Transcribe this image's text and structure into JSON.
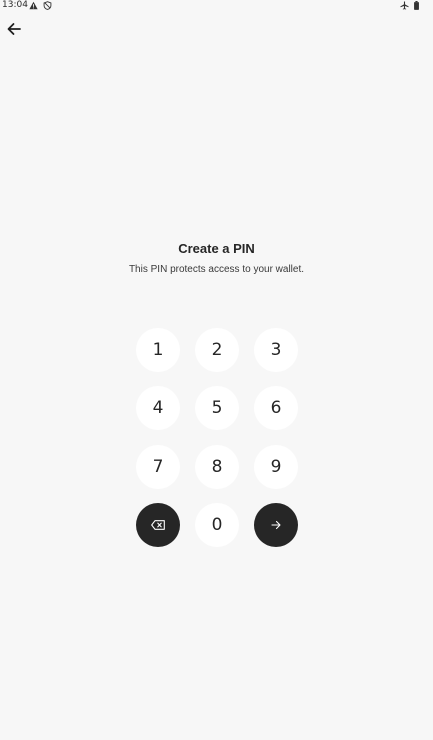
{
  "status_bar": {
    "time": "13:04",
    "left_icons": [
      "warning-icon",
      "shield-icon"
    ],
    "right_icons": [
      "airplane-icon",
      "battery-icon"
    ]
  },
  "header": {
    "back_icon": "arrow-left-icon"
  },
  "content": {
    "title": "Create a PIN",
    "subtitle": "This PIN protects access to your wallet."
  },
  "keypad": {
    "keys": [
      "1",
      "2",
      "3",
      "4",
      "5",
      "6",
      "7",
      "8",
      "9",
      "0"
    ],
    "delete_icon": "backspace-icon",
    "next_icon": "arrow-right-icon",
    "action_color": "#262626",
    "key_color": "#ffffff"
  }
}
